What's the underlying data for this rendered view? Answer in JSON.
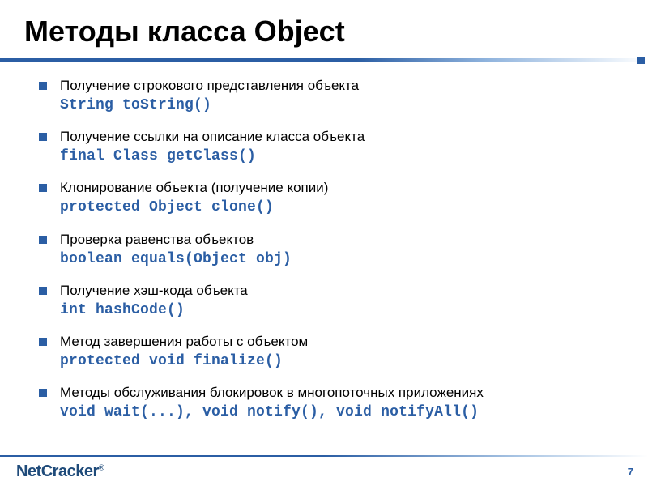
{
  "title": "Методы класса Object",
  "items": [
    {
      "text": "Получение строкового представления объекта",
      "code": "String toString()"
    },
    {
      "text": "Получение ссылки на описание класса объекта",
      "code": "final Class getClass()"
    },
    {
      "text": "Клонирование объекта (получение копии)",
      "code": "protected Object clone()"
    },
    {
      "text": "Проверка равенства объектов",
      "code": "boolean equals(Object obj)"
    },
    {
      "text": "Получение хэш-кода объекта",
      "code": "int hashCode()"
    },
    {
      "text": "Метод завершения работы с объектом",
      "code": "protected void finalize()"
    },
    {
      "text": "Методы обслуживания блокировок в многопоточных приложениях",
      "code": "void wait(...), void notify(), void notifyAll()"
    }
  ],
  "footer": {
    "logo_net": "Net",
    "logo_cracker": "Cracker",
    "logo_reg": "®",
    "page": "7"
  }
}
